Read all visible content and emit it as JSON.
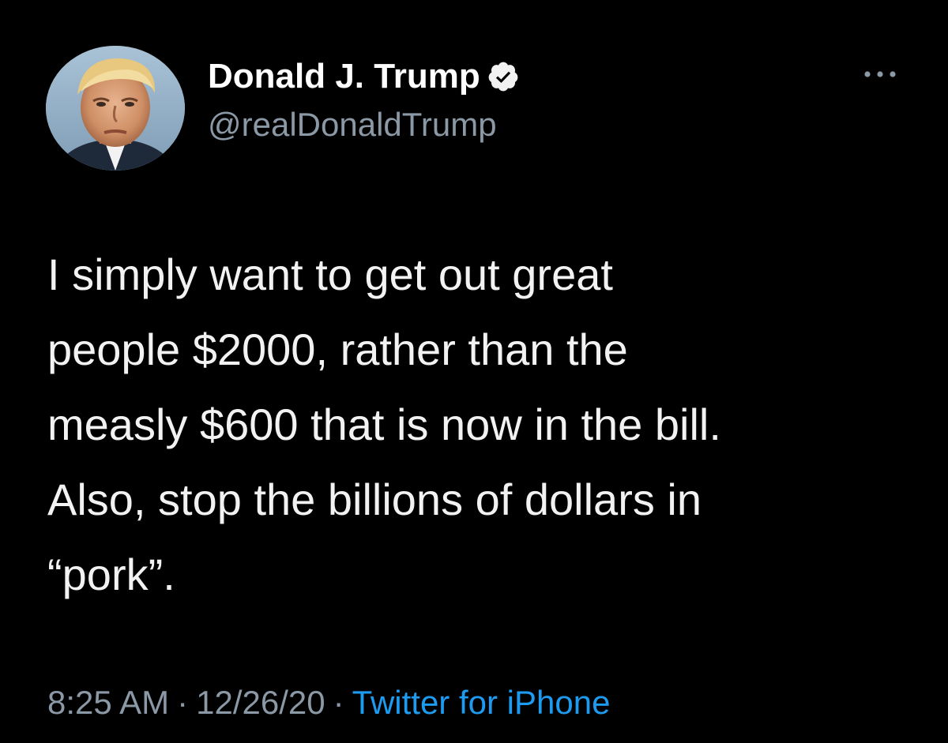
{
  "author": {
    "display_name": "Donald J. Trump",
    "handle": "@realDonaldTrump",
    "verified": true
  },
  "tweet": {
    "lines": [
      "I simply want to get out great",
      "people $2000, rather than the",
      "measly $600 that is now in the bill.",
      "Also, stop the billions of dollars in",
      "“pork”."
    ]
  },
  "meta": {
    "time": "8:25 AM",
    "separator": "·",
    "date": "12/26/20",
    "source": "Twitter for iPhone"
  },
  "icons": {
    "avatar": "profile-photo",
    "verified": "verified-badge-icon",
    "more": "more-options-icon"
  },
  "colors": {
    "background": "#000000",
    "text": "#f2f2f2",
    "secondary": "#8b98a5",
    "link": "#1d9bf0"
  }
}
